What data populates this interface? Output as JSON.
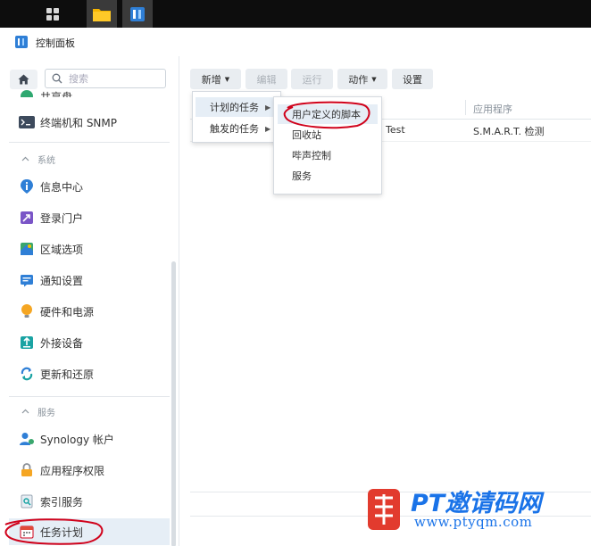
{
  "window": {
    "title": "控制面板"
  },
  "sidebar": {
    "search_placeholder": "搜索",
    "partial_top_label": "共享盘",
    "items_top": [
      {
        "label": "终端机和 SNMP",
        "icon": "terminal-icon"
      }
    ],
    "sections": [
      {
        "label": "系统",
        "items": [
          {
            "label": "信息中心",
            "icon": "info-icon"
          },
          {
            "label": "登录门户",
            "icon": "login-portal-icon"
          },
          {
            "label": "区域选项",
            "icon": "region-icon"
          },
          {
            "label": "通知设置",
            "icon": "notification-icon"
          },
          {
            "label": "硬件和电源",
            "icon": "hardware-power-icon"
          },
          {
            "label": "外接设备",
            "icon": "external-device-icon"
          },
          {
            "label": "更新和还原",
            "icon": "update-restore-icon"
          }
        ]
      },
      {
        "label": "服务",
        "items": [
          {
            "label": "Synology 帐户",
            "icon": "account-icon"
          },
          {
            "label": "应用程序权限",
            "icon": "lock-icon"
          },
          {
            "label": "索引服务",
            "icon": "index-icon"
          },
          {
            "label": "任务计划",
            "icon": "calendar-icon"
          }
        ]
      }
    ]
  },
  "toolbar": {
    "create": "新增",
    "edit": "编辑",
    "run": "运行",
    "action": "动作",
    "settings": "设置"
  },
  "table": {
    "columns": [
      "应用程序"
    ],
    "rows": [
      {
        "name": ". Test",
        "app": "S.M.A.R.T. 检测"
      }
    ]
  },
  "menu_create": {
    "items": [
      "计划的任务",
      "触发的任务"
    ]
  },
  "menu_scheduled": {
    "items": [
      "用户定义的脚本",
      "回收站",
      "哔声控制",
      "服务"
    ]
  },
  "watermark": {
    "brand": "PT邀请码网",
    "url": "www.ptyqm.com"
  },
  "colors": {
    "accent": "#1a73e8",
    "annotation": "#d0021b",
    "active_bg": "#e6eef6"
  }
}
